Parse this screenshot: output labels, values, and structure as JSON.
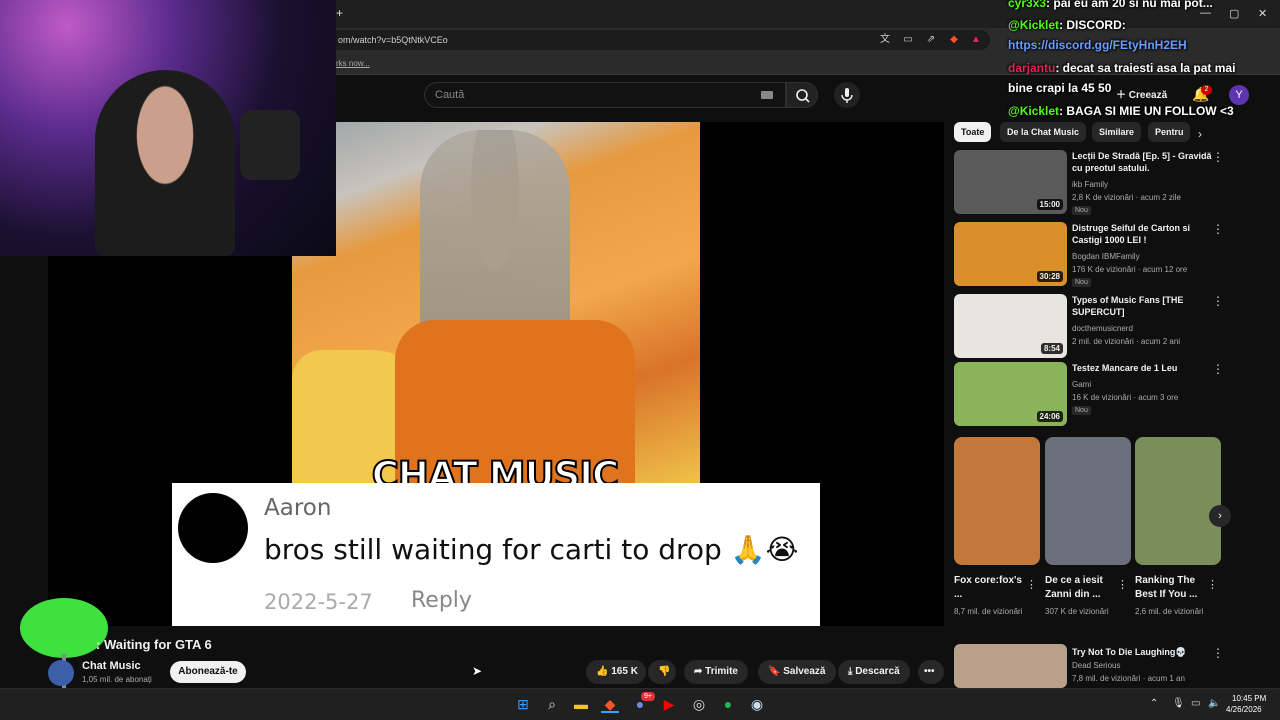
{
  "browser": {
    "url": "om/watch?v=b5QtNtkVCEo",
    "bookmark_text": "rks now...",
    "new_tab": "+",
    "minimize": "—",
    "maximize": "▢",
    "close": "✕"
  },
  "header": {
    "search_placeholder": "Caută",
    "create_label": "Creează",
    "notifications_count": "2",
    "avatar_letter": "Y"
  },
  "video": {
    "overlay_title": "CHAT MUSIC",
    "comment_user": "Aaron",
    "comment_text": "bros still waiting for carti to drop 🙏😭",
    "comment_date": "2022-5-27",
    "comment_reply": "Reply",
    "title": ": Waiting for GTA 6",
    "channel_name": "Chat Music",
    "channel_subs": "1,05 mil. de abonați",
    "subscribe_label": "Abonează-te",
    "likes": "165 K",
    "share_label": "Trimite",
    "save_label": "Salvează",
    "download_label": "Descarcă",
    "more_label": "•••"
  },
  "chips": [
    "Toate",
    "De la Chat Music",
    "Similare",
    "Pentru"
  ],
  "recommendations": [
    {
      "title": "Lecții De Stradă [Ep. 5] - Gravidă cu preotul satului.",
      "channel": "ikb Family",
      "meta": "2,8 K de vizionări · acum 2 zile",
      "duration": "15:00",
      "badge": "Nou",
      "color": "#5a5a5a"
    },
    {
      "title": "Distruge Seiful de Carton si Castigi 1000 LEI !",
      "channel": "Bogdan IBMFamily",
      "meta": "176 K de vizionări · acum 12 ore",
      "duration": "30:28",
      "badge": "Nou",
      "color": "#d9902a"
    },
    {
      "title": "Types of Music Fans [THE SUPERCUT]",
      "channel": "docthemusicnerd",
      "meta": "2 mil. de vizionări · acum 2 ani",
      "duration": "8:54",
      "badge": "",
      "color": "#e8e4e0"
    },
    {
      "title": "Testez Mancare de 1 Leu",
      "channel": "Gami",
      "meta": "16 K de vizionări · acum 3 ore",
      "duration": "24:06",
      "badge": "Nou",
      "color": "#8ab35a"
    }
  ],
  "shorts": [
    {
      "title": "Fox core:fox's ...",
      "views": "8,7 mil. de vizionări",
      "color": "#c2783a"
    },
    {
      "title": "De ce a iesit Zanni din ...",
      "views": "307 K de vizionări",
      "color": "#6a6f7a"
    },
    {
      "title": "Ranking The Best If You ...",
      "views": "2,6 mil. de vizionări",
      "color": "#7a8d5a"
    }
  ],
  "rec_bottom": {
    "title": "Try Not To Die Laughing💀",
    "channel": "Dead Serious",
    "meta": "7,8 mil. de vizionări · acum 1 an"
  },
  "chat": {
    "line1_user": "cyr3x3",
    "line1_text": ": pai eu am 20 si nu mai pot...",
    "line2_user": "@Kicklet",
    "line2_text": ": DISCORD:",
    "line2_link": "https://discord.gg/FEtyHnH2EH",
    "line3_user": "darjantu",
    "line3_text": ": decat sa traiesti asa la pat mai",
    "line3_text2": "bine crapi la 45 50",
    "line4_user": "@Kicklet",
    "line4_text": ": BAGA SI MIE UN FOLLOW <3"
  },
  "taskbar": {
    "time": "10:45 PM",
    "date": "4/26/2026",
    "discord_badge": "9+"
  },
  "icons": {
    "search": "search-icon",
    "mic": "mic-icon",
    "bell": "bell-icon",
    "like": "thumbs-up-icon",
    "dislike": "thumbs-down-icon"
  }
}
